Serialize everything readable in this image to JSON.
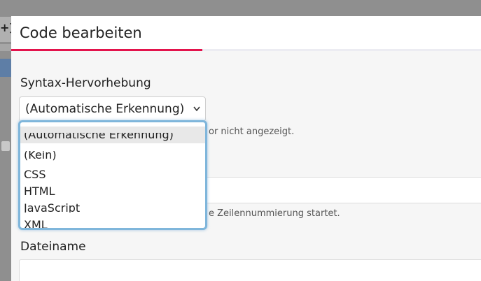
{
  "background": {
    "bracket_text": "+]"
  },
  "modal": {
    "title": "Code bearbeiten",
    "syntax": {
      "label": "Syntax-Hervorhebung",
      "selected": "(Automatische Erkennung)",
      "help_suffix": "or nicht angezeigt."
    },
    "line_numbers": {
      "help_suffix": "e Zeilennummierung startet."
    },
    "filename": {
      "label": "Dateiname"
    },
    "dropdown_options": [
      "(Automatische Erkennung)",
      "(Kein)",
      "CSS",
      "HTML",
      "JavaScript",
      "XML"
    ]
  },
  "colors": {
    "accent": "#e3134c",
    "focus_ring": "#7fb6db"
  }
}
